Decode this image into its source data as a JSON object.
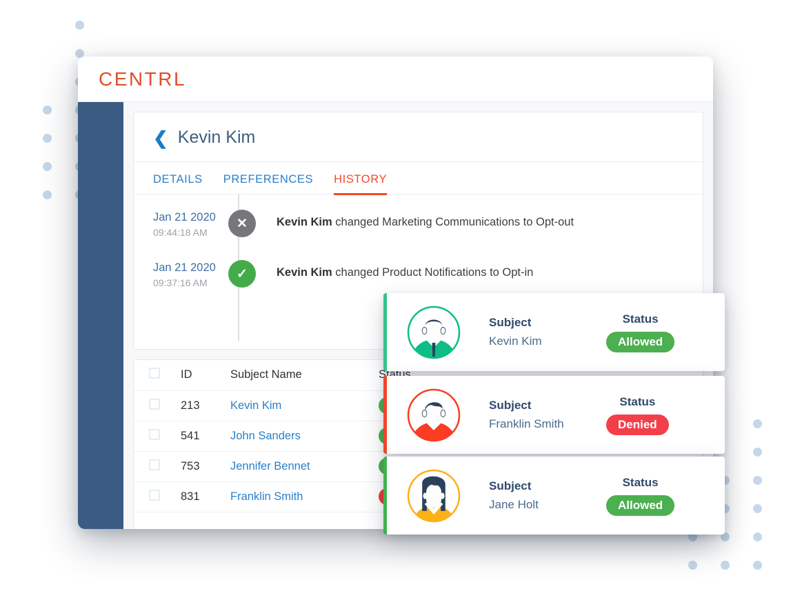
{
  "brand": {
    "name": "CENTRL",
    "color": "#e04e2a"
  },
  "sidebar": {
    "color": "#3a5c82"
  },
  "detail": {
    "back_icon": "chevron-left-icon",
    "title": "Kevin Kim",
    "tabs": [
      {
        "label": "DETAILS",
        "active": false
      },
      {
        "label": "PREFERENCES",
        "active": false
      },
      {
        "label": "HISTORY",
        "active": true
      }
    ]
  },
  "history": {
    "entries": [
      {
        "date": "Jan 21 2020",
        "time": "09:44:18 AM",
        "icon": "close-circle-icon",
        "status": "negative",
        "actor": "Kevin Kim",
        "text": " changed Marketing Communications to Opt-out"
      },
      {
        "date": "Jan 21 2020",
        "time": "09:37:16 AM",
        "icon": "check-circle-icon",
        "status": "positive",
        "actor": "Kevin Kim",
        "text": " changed Product Notifications to Opt-in"
      }
    ]
  },
  "table": {
    "columns": [
      "",
      "ID",
      "Subject  Name",
      "Status"
    ],
    "rows": [
      {
        "id": "213",
        "name": "Kevin Kim",
        "status": "Allowed"
      },
      {
        "id": "541",
        "name": "John Sanders",
        "status": "Allowed"
      },
      {
        "id": "753",
        "name": "Jennifer Bennet",
        "status": "Allowed"
      },
      {
        "id": "831",
        "name": "Franklin Smith",
        "status": "Denied"
      }
    ]
  },
  "float_cards": [
    {
      "subject_label": "Subject",
      "subject_value": "Kevin Kim",
      "status_label": "Status",
      "status_value": "Allowed",
      "avatar": "male-avatar-icon",
      "accent": "#34c28a"
    },
    {
      "subject_label": "Subject",
      "subject_value": "Franklin Smith",
      "status_label": "Status",
      "status_value": "Denied",
      "avatar": "male-avatar-icon",
      "accent": "#f0452d"
    },
    {
      "subject_label": "Subject",
      "subject_value": "Jane Holt",
      "status_label": "Status",
      "status_value": "Allowed",
      "avatar": "female-avatar-icon",
      "accent": "#fbb03b"
    }
  ]
}
